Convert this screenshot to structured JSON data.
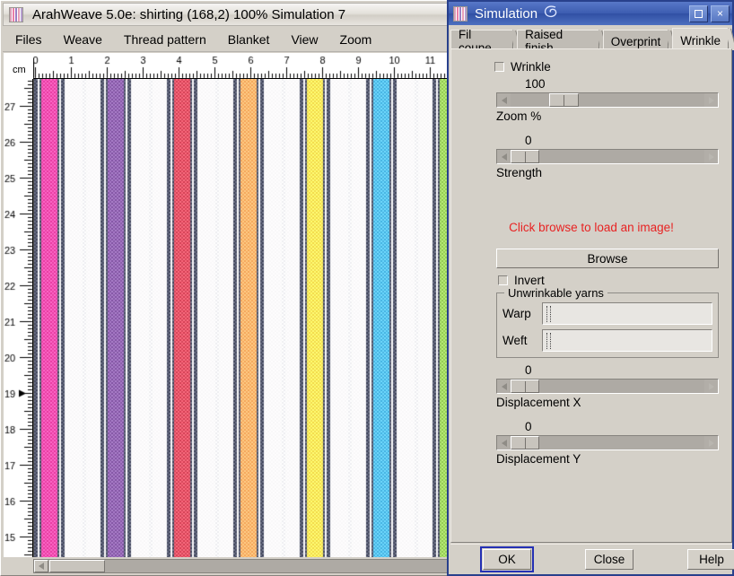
{
  "main_window": {
    "title": "ArahWeave 5.0e: shirting (168,2) 100% Simulation 7",
    "app_icon": "stripes-icon",
    "menu": [
      {
        "label": "Files"
      },
      {
        "label": "Weave"
      },
      {
        "label": "Thread pattern"
      },
      {
        "label": "Blanket"
      },
      {
        "label": "View"
      },
      {
        "label": "Zoom"
      }
    ],
    "rulers": {
      "unit_label": "cm",
      "horizontal_ticks": [
        "0",
        "1",
        "2",
        "3",
        "4",
        "5",
        "6",
        "7",
        "8",
        "9",
        "10",
        "11"
      ],
      "vertical_ticks": [
        "27",
        "26",
        "25",
        "24",
        "23",
        "22",
        "21",
        "20",
        "19",
        "18",
        "17",
        "16",
        "15"
      ],
      "vertical_marker_at": "19"
    },
    "scrollbar": {
      "left_arrow": "left-arrow-icon"
    },
    "fabric": {
      "description": "Woven shirting stripe simulation",
      "stripe_colors": [
        "#e5369b",
        "#7d4f9e",
        "#cf3b4f",
        "#f4a055",
        "#f2d544",
        "#3fadde",
        "#8cc44a"
      ],
      "dark_edge_color": "#3a3f55",
      "ground_color": "#f2f0f4"
    }
  },
  "sim_dialog": {
    "title": "Simulation",
    "icon": "stripes-icon",
    "title_decoration": "swirl-icon",
    "titlebar_buttons": [
      {
        "name": "maximize-button",
        "glyph": "□"
      },
      {
        "name": "close-button",
        "glyph": "×"
      }
    ],
    "tabs": [
      {
        "label": "Fil coupe",
        "active": false
      },
      {
        "label": "Raised finish",
        "active": false
      },
      {
        "label": "Overprint",
        "active": false
      },
      {
        "label": "Wrinkle",
        "active": true
      }
    ],
    "wrinkle_checkbox": {
      "label": "Wrinkle",
      "checked": false
    },
    "sliders": [
      {
        "name": "zoom-percent",
        "value": "100",
        "label": "Zoom %",
        "thumb_pct": 20,
        "thumb_width_pct": 15
      },
      {
        "name": "strength",
        "value": "0",
        "label": "Strength",
        "thumb_pct": 0,
        "thumb_width_pct": 15
      },
      {
        "name": "displacement-x",
        "value": "0",
        "label": "Displacement X",
        "thumb_pct": 0,
        "thumb_width_pct": 15
      },
      {
        "name": "displacement-y",
        "value": "0",
        "label": "Displacement Y",
        "thumb_pct": 0,
        "thumb_width_pct": 15
      }
    ],
    "hint": "Click browse to load an image!",
    "hint_color": "#e82222",
    "browse_button": "Browse",
    "invert_checkbox": {
      "label": "Invert",
      "checked": false
    },
    "unwrinkable_group": {
      "title": "Unwrinkable yarns",
      "warp": {
        "label": "Warp",
        "value": "",
        "placeholder": ""
      },
      "weft": {
        "label": "Weft",
        "value": "",
        "placeholder": ""
      }
    },
    "buttons": [
      {
        "name": "ok-button",
        "label": "OK",
        "default": true
      },
      {
        "name": "close-button",
        "label": "Close",
        "default": false
      },
      {
        "name": "help-button",
        "label": "Help",
        "default": false
      }
    ]
  }
}
